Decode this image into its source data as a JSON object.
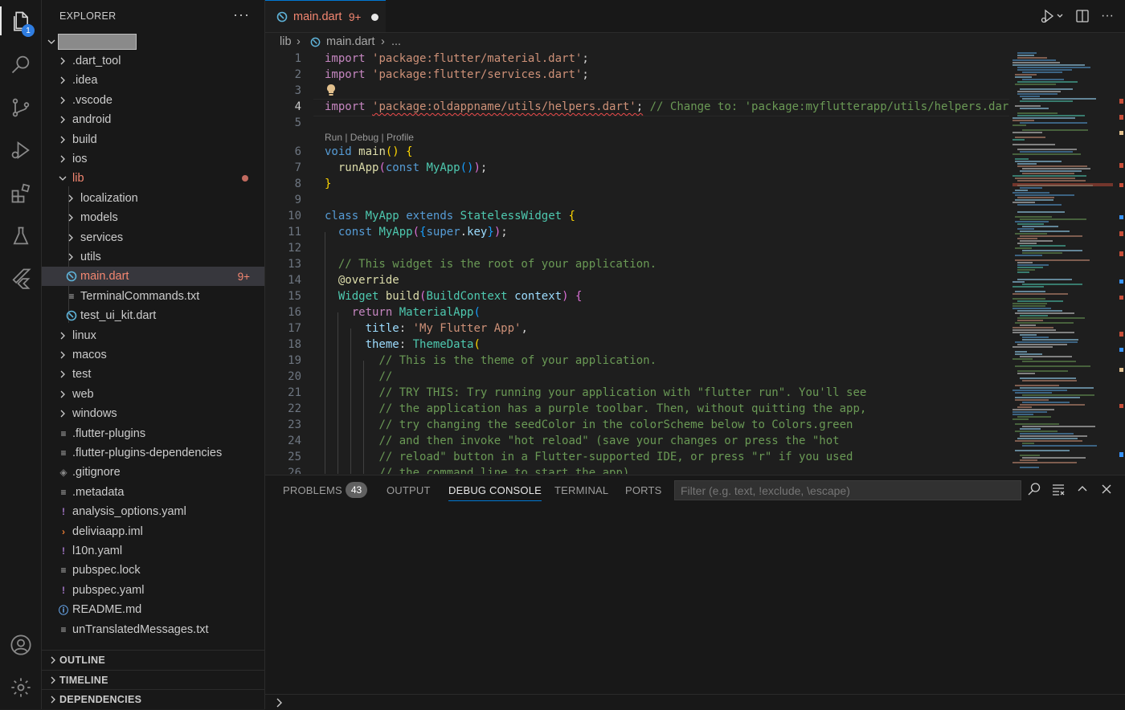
{
  "activity_bar": {
    "explorer_badge": "1",
    "items": [
      "files-icon",
      "search-icon",
      "source-control-icon",
      "run-debug-icon",
      "extensions-icon",
      "testing-icon",
      "flutter-icon"
    ],
    "bottom": [
      "account-icon",
      "settings-gear-icon"
    ]
  },
  "sidebar": {
    "title": "EXPLORER",
    "more": "···",
    "tree": [
      {
        "label": ".dart_tool",
        "type": "folder"
      },
      {
        "label": ".idea",
        "type": "folder"
      },
      {
        "label": ".vscode",
        "type": "folder"
      },
      {
        "label": "android",
        "type": "folder"
      },
      {
        "label": "build",
        "type": "folder"
      },
      {
        "label": "ios",
        "type": "folder"
      },
      {
        "label": "lib",
        "type": "folder-open"
      },
      {
        "label": "localization",
        "type": "folder"
      },
      {
        "label": "models",
        "type": "folder"
      },
      {
        "label": "services",
        "type": "folder"
      },
      {
        "label": "utils",
        "type": "folder"
      },
      {
        "label": "main.dart",
        "type": "dart",
        "badge": "9+"
      },
      {
        "label": "TerminalCommands.txt",
        "type": "text"
      },
      {
        "label": "test_ui_kit.dart",
        "type": "dart"
      },
      {
        "label": "linux",
        "type": "folder"
      },
      {
        "label": "macos",
        "type": "folder"
      },
      {
        "label": "test",
        "type": "folder"
      },
      {
        "label": "web",
        "type": "folder"
      },
      {
        "label": "windows",
        "type": "folder"
      },
      {
        "label": ".flutter-plugins",
        "type": "text"
      },
      {
        "label": ".flutter-plugins-dependencies",
        "type": "text"
      },
      {
        "label": ".gitignore",
        "type": "git"
      },
      {
        "label": ".metadata",
        "type": "text"
      },
      {
        "label": "analysis_options.yaml",
        "type": "yaml"
      },
      {
        "label": "deliviaapp.iml",
        "type": "rss"
      },
      {
        "label": "l10n.yaml",
        "type": "yaml"
      },
      {
        "label": "pubspec.lock",
        "type": "text"
      },
      {
        "label": "pubspec.yaml",
        "type": "yaml"
      },
      {
        "label": "README.md",
        "type": "info"
      },
      {
        "label": "unTranslatedMessages.txt",
        "type": "text"
      }
    ],
    "sections": [
      "OUTLINE",
      "TIMELINE",
      "DEPENDENCIES"
    ]
  },
  "tab": {
    "label": "main.dart",
    "count": "9+"
  },
  "breadcrumb": {
    "folder": "lib",
    "file": "main.dart",
    "rest": "..."
  },
  "editor": {
    "codelens": "Run | Debug | Profile",
    "line_numbers": [
      "1",
      "2",
      "3",
      "4",
      "5",
      "6",
      "7",
      "8",
      "9",
      "10",
      "11",
      "12",
      "13",
      "14",
      "15",
      "16",
      "17",
      "18",
      "19",
      "20",
      "21",
      "22",
      "23",
      "24",
      "25",
      "26"
    ],
    "current_line": "4"
  },
  "panel": {
    "tabs": [
      "PROBLEMS",
      "OUTPUT",
      "DEBUG CONSOLE",
      "TERMINAL",
      "PORTS"
    ],
    "problems_count": "43",
    "filter_placeholder": "Filter (e.g. text, !exclude, \\escape)"
  },
  "colors": {
    "accent": "#0078d4",
    "error": "#f48771",
    "badge": "#2f7de1"
  }
}
